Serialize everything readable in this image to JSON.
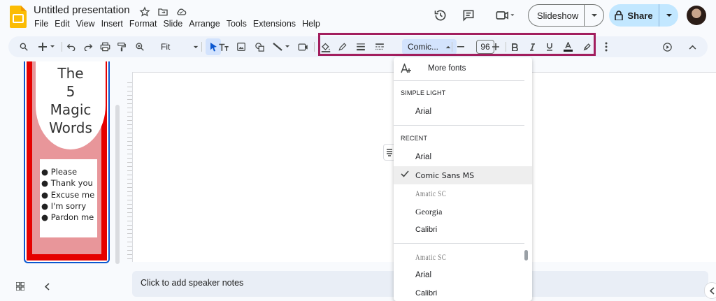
{
  "app": {
    "title": "Untitled presentation",
    "menu": [
      "File",
      "Edit",
      "View",
      "Insert",
      "Format",
      "Slide",
      "Arrange",
      "Tools",
      "Extensions",
      "Help"
    ],
    "slideshow_label": "Slideshow",
    "share_label": "Share",
    "accent_color": "#c2e7ff",
    "highlight_color": "#a21e5e"
  },
  "toolbar": {
    "zoom_value": "Fit",
    "font_name": "Comic...",
    "font_size": "96"
  },
  "slide_thumbnail": {
    "title_lines": [
      "The",
      "5",
      "Magic",
      "Words"
    ],
    "bullets": [
      "Please",
      "Thank you",
      "Excuse me",
      "I'm sorry",
      "Pardon me"
    ]
  },
  "notes": {
    "placeholder": "Click to add speaker notes"
  },
  "font_menu": {
    "more_fonts": "More fonts",
    "section_theme": "SIMPLE LIGHT",
    "theme_fonts": [
      "Arial"
    ],
    "section_recent": "RECENT",
    "recent_fonts": [
      "Arial",
      "Comic Sans MS",
      "Amatic SC",
      "Georgia",
      "Calibri"
    ],
    "selected_font": "Comic Sans MS",
    "all_fonts": [
      "Amatic SC",
      "Arial",
      "Calibri"
    ]
  }
}
